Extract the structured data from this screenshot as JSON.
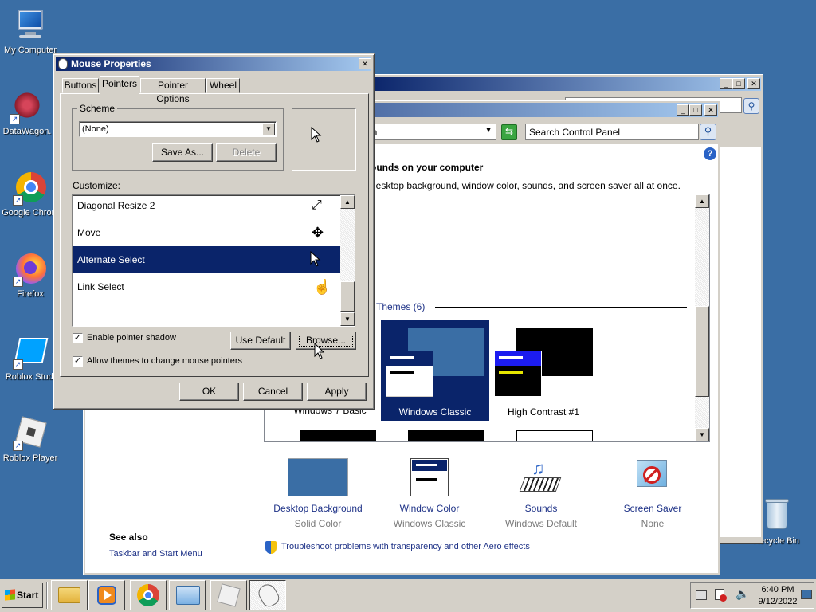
{
  "desktop": {
    "icons": [
      {
        "label": "My Computer"
      },
      {
        "label": "DataWagon."
      },
      {
        "label": "Google Chrom"
      },
      {
        "label": "Firefox"
      },
      {
        "label": "Roblox Studi"
      },
      {
        "label": "Roblox Player"
      },
      {
        "label": "Recycle Bin"
      }
    ]
  },
  "control_panel": {
    "address_partial": "on",
    "search_placeholder": "Search Control Panel",
    "heading": "ounds on your computer",
    "description": "desktop background, window color, sounds, and screen saver all at once.",
    "themes_group": "Themes (6)",
    "themes": [
      {
        "label": "Windows 7 Basic"
      },
      {
        "label": "Windows Classic"
      },
      {
        "label": "High Contrast #1"
      }
    ],
    "items": [
      {
        "title": "Desktop Background",
        "sub": "Solid Color"
      },
      {
        "title": "Window Color",
        "sub": "Windows Classic"
      },
      {
        "title": "Sounds",
        "sub": "Windows Default"
      },
      {
        "title": "Screen Saver",
        "sub": "None"
      }
    ],
    "see_also_title": "See also",
    "see_also_link": "Taskbar and Start Menu",
    "troubleshoot": "Troubleshoot problems with transparency and other Aero effects"
  },
  "mouse_dialog": {
    "title": "Mouse Properties",
    "tabs": [
      "Buttons",
      "Pointers",
      "Pointer Options",
      "Wheel"
    ],
    "scheme_label": "Scheme",
    "scheme_value": "(None)",
    "save_as": "Save As...",
    "delete": "Delete",
    "customize_label": "Customize:",
    "pointers": [
      {
        "name": "Diagonal Resize 2"
      },
      {
        "name": "Move"
      },
      {
        "name": "Alternate Select"
      },
      {
        "name": "Link Select"
      }
    ],
    "enable_shadow": "Enable pointer shadow",
    "allow_themes": "Allow themes to change mouse pointers",
    "use_default": "Use Default",
    "browse": "Browse...",
    "ok": "OK",
    "cancel": "Cancel",
    "apply": "Apply"
  },
  "taskbar": {
    "start": "Start",
    "time": "6:40 PM",
    "date": "9/12/2022"
  },
  "colors": {
    "desktop": "#3a6ea5",
    "titlebar_start": "#0a246a",
    "titlebar_end": "#a6caf0",
    "selection": "#0a246a",
    "face": "#d4d0c8"
  }
}
